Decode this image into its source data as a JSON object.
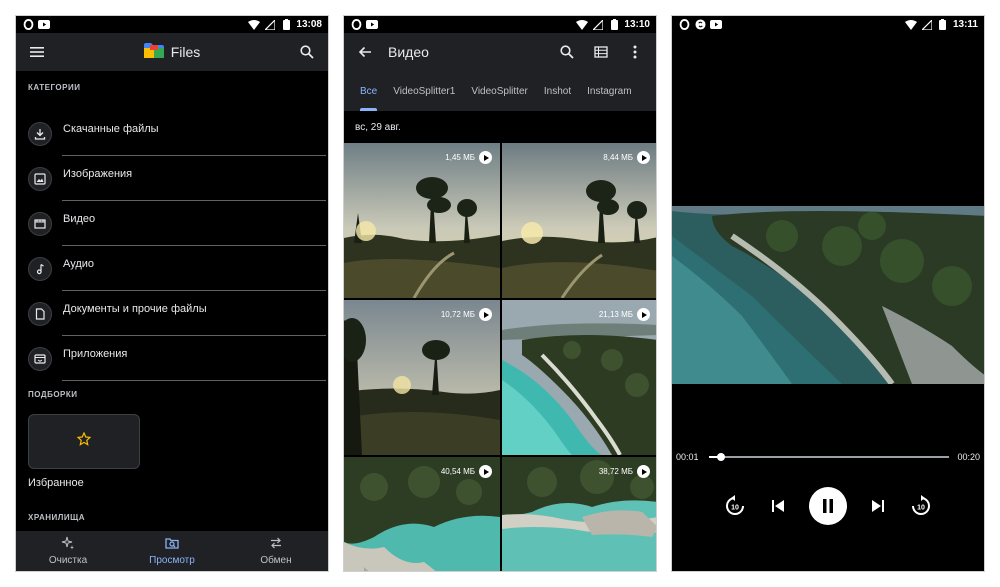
{
  "files_screen": {
    "status": {
      "time": "13:08"
    },
    "appbar": {
      "title": "Files"
    },
    "categories_label": "КАТЕГОРИИ",
    "categories": [
      {
        "label": "Скачанные файлы",
        "icon": "download-icon"
      },
      {
        "label": "Изображения",
        "icon": "image-icon"
      },
      {
        "label": "Видео",
        "icon": "video-icon"
      },
      {
        "label": "Аудио",
        "icon": "audio-icon"
      },
      {
        "label": "Документы и прочие файлы",
        "icon": "document-icon"
      },
      {
        "label": "Приложения",
        "icon": "apps-icon"
      }
    ],
    "collections_label": "ПОДБОРКИ",
    "favorites_label": "Избранное",
    "storage_label": "ХРАНИЛИЩА",
    "bottom_nav": [
      {
        "label": "Очистка",
        "icon": "sparkle-icon",
        "active": false
      },
      {
        "label": "Просмотр",
        "icon": "browse-icon",
        "active": true
      },
      {
        "label": "Обмен",
        "icon": "swap-icon",
        "active": false
      }
    ]
  },
  "video_list_screen": {
    "status": {
      "time": "13:10"
    },
    "appbar": {
      "title": "Видео"
    },
    "tabs": [
      {
        "label": "Все",
        "active": true
      },
      {
        "label": "VideoSplitter1",
        "active": false
      },
      {
        "label": "VideoSplitter",
        "active": false
      },
      {
        "label": "Inshot",
        "active": false
      },
      {
        "label": "Instagram",
        "active": false
      }
    ],
    "date_header": "вс, 29 авг.",
    "videos": [
      {
        "size": "1,45 МБ",
        "scene": "forest-sunset"
      },
      {
        "size": "8,44 МБ",
        "scene": "forest-sunset"
      },
      {
        "size": "10,72 МБ",
        "scene": "forest-dusk"
      },
      {
        "size": "21,13 МБ",
        "scene": "coast"
      },
      {
        "size": "40,54 МБ",
        "scene": "cliff"
      },
      {
        "size": "38,72 МБ",
        "scene": "cliff-bay"
      }
    ]
  },
  "player_screen": {
    "status": {
      "time": "13:11"
    },
    "elapsed": "00:01",
    "duration": "00:20",
    "progress": 0.05
  },
  "colors": {
    "accent": "#8ab4f8",
    "surface": "#202124",
    "background": "#000000"
  }
}
